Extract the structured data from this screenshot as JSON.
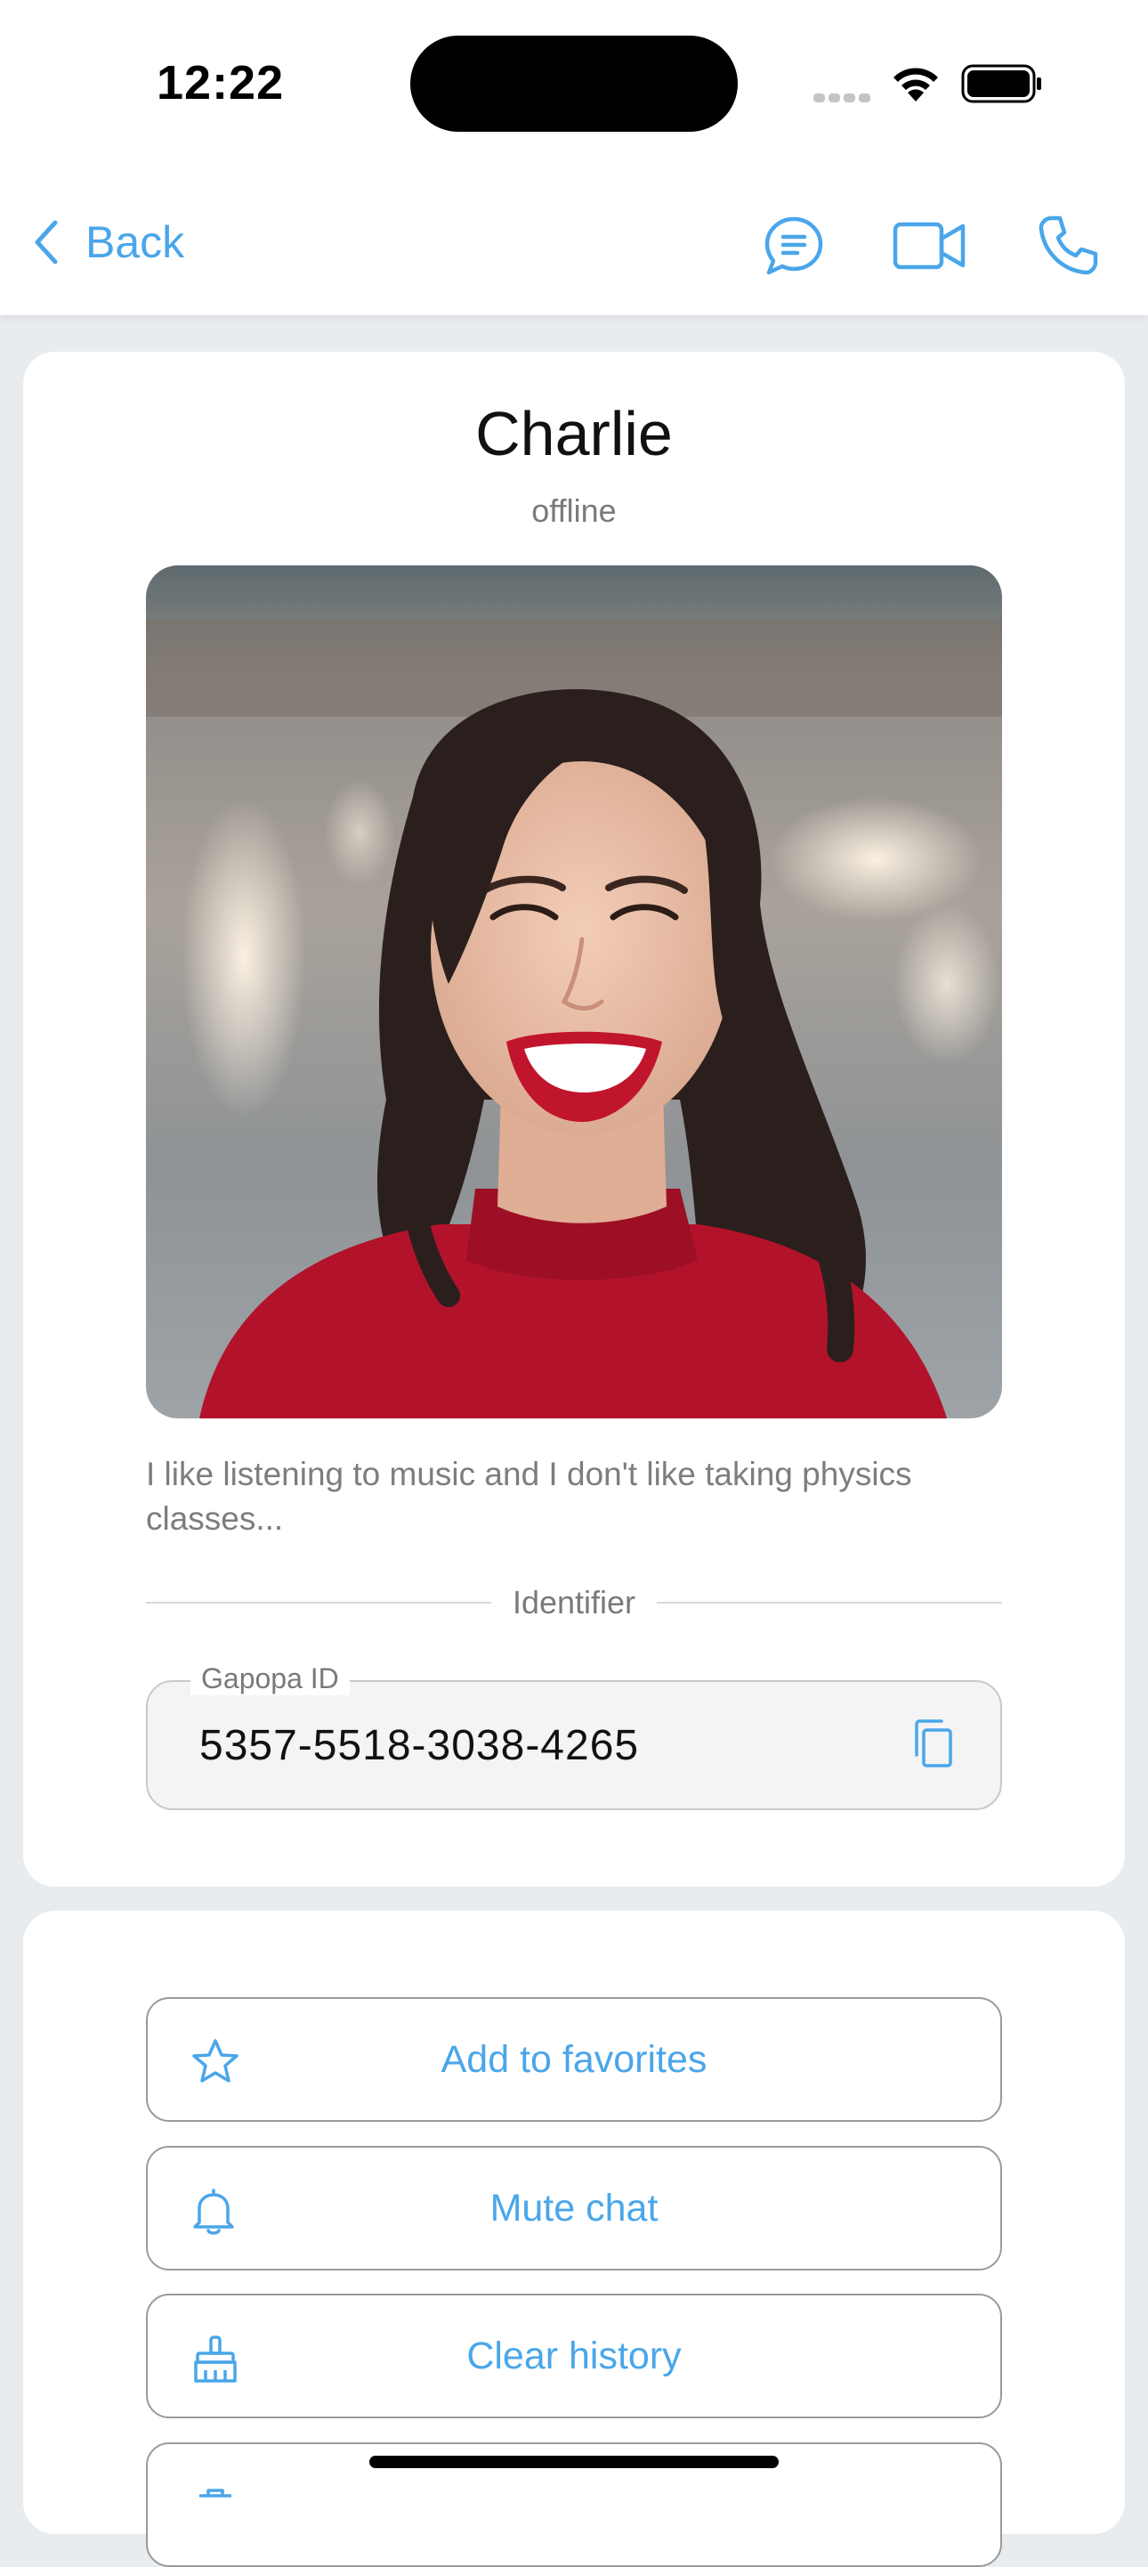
{
  "status_bar": {
    "time": "12:22"
  },
  "nav": {
    "back_label": "Back",
    "icons": [
      "chat-icon",
      "video-call-icon",
      "phone-icon"
    ],
    "accent_color": "#4aa6ea"
  },
  "profile": {
    "name": "Charlie",
    "status": "offline",
    "bio": "I like listening to music and I don't like taking physics classes...",
    "section_label": "Identifier",
    "id_field": {
      "label": "Gapopa ID",
      "value": "5357-5518-3038-4265"
    }
  },
  "actions": [
    {
      "label": "Add to favorites",
      "icon": "star-icon"
    },
    {
      "label": "Mute chat",
      "icon": "bell-icon"
    },
    {
      "label": "Clear history",
      "icon": "broom-icon"
    }
  ]
}
